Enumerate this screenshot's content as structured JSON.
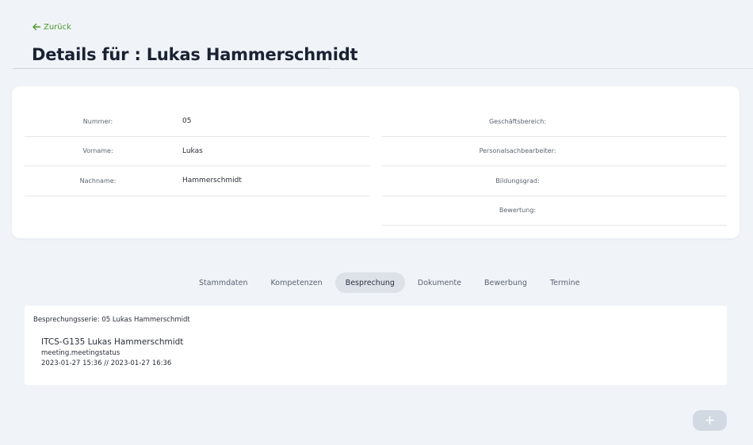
{
  "header": {
    "back_label": "Zurück",
    "title": "Details für : Lukas Hammerschmidt"
  },
  "details": {
    "left": [
      {
        "label": "Nummer:",
        "value": "05"
      },
      {
        "label": "Vorname:",
        "value": "Lukas"
      },
      {
        "label": "Nachname:",
        "value": "Hammerschmidt"
      }
    ],
    "right": [
      {
        "label": "Geschäftsbereich:",
        "value": ""
      },
      {
        "label": "Personalsachbearbeiter:",
        "value": ""
      },
      {
        "label": "Bildungsgrad:",
        "value": ""
      },
      {
        "label": "Bewertung:",
        "value": ""
      }
    ]
  },
  "tabs": [
    {
      "label": "Stammdaten",
      "active": false
    },
    {
      "label": "Kompetenzen",
      "active": false
    },
    {
      "label": "Besprechung",
      "active": true
    },
    {
      "label": "Dokumente",
      "active": false
    },
    {
      "label": "Bewerbung",
      "active": false
    },
    {
      "label": "Termine",
      "active": false
    }
  ],
  "meetings": {
    "series_label": "Besprechungsserie: 05 Lukas Hammerschmidt",
    "items": [
      {
        "title": "ITCS-G135 Lukas Hammerschmidt",
        "status": "meeting.meetingstatus",
        "time": "2023-01-27 15:36 // 2023-01-27 16:36"
      }
    ]
  },
  "add_button": {
    "label": "+"
  },
  "colors": {
    "background": "#f0f3f8",
    "accent_green": "#4a9a2a",
    "active_tab": "#dde1e8",
    "add_button": "#d3d9e2"
  }
}
